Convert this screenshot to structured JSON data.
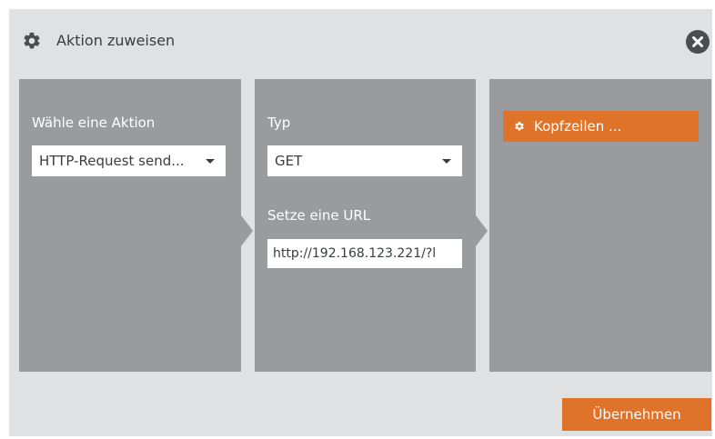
{
  "dialog": {
    "title": "Aktion zuweisen",
    "title_icon": "gear-icon",
    "close_icon": "close-icon"
  },
  "panel1": {
    "label": "Wähle eine Aktion",
    "action_select_value": "HTTP-Request send..."
  },
  "panel2": {
    "type_label": "Typ",
    "type_select_value": "GET",
    "url_label": "Setze eine URL",
    "url_value": "http://192.168.123.221/?l"
  },
  "panel3": {
    "headers_button": "Kopfzeilen ..."
  },
  "footer": {
    "apply_button": "Übernehmen"
  },
  "colors": {
    "accent": "#e0732a",
    "panel": "#9a9b9f",
    "background": "#dfe1e3"
  }
}
